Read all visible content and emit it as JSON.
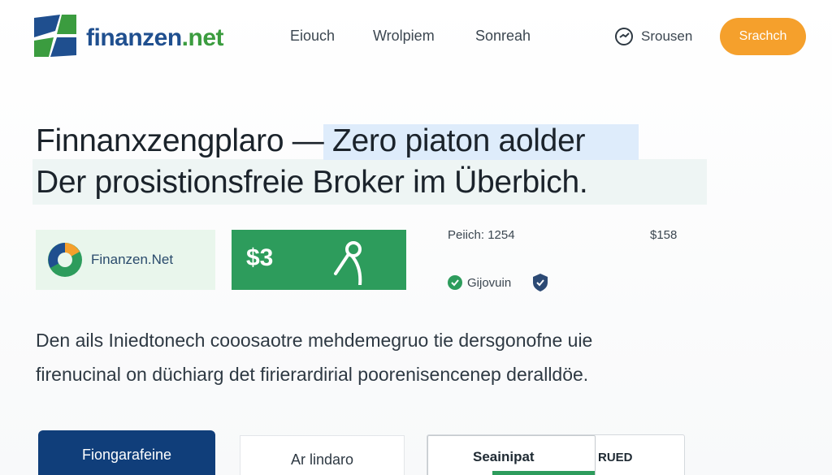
{
  "header": {
    "logo": {
      "text_a": "finanzen",
      "text_b": ".net"
    },
    "nav": [
      "Eiouch",
      "Wrolpiem",
      "Sonreah"
    ],
    "search_label": "Srousen",
    "cta_label": "Srachch"
  },
  "headline": {
    "line1": "Finnanxzengplaro — Zero piaton aolder",
    "line2": "Der prosistionsfreie Broker im Überbich."
  },
  "cards": {
    "brand_label": "Finanzen.Net",
    "price_tag": "$3",
    "meta_label": "Peiich:  1254",
    "meta_value": "$158",
    "verified_label": "Gijovuin"
  },
  "paragraph": {
    "line1": "Den ails Iniedtonech cooosaotre mehdemegruo tie dersgonofne uie",
    "line2": "firenucinal on düchiarg det firierardirial poorenisencenep deralldöe."
  },
  "buttons": {
    "primary_label": "Fiongarafeine",
    "secondary_label": "Ar lindaro",
    "panel_label": "Seainipat",
    "panel_tag": "RUED"
  },
  "colors": {
    "accent": "#f5a02c",
    "brand_blue": "#103e7a",
    "brand_green": "#2d9c5c"
  }
}
